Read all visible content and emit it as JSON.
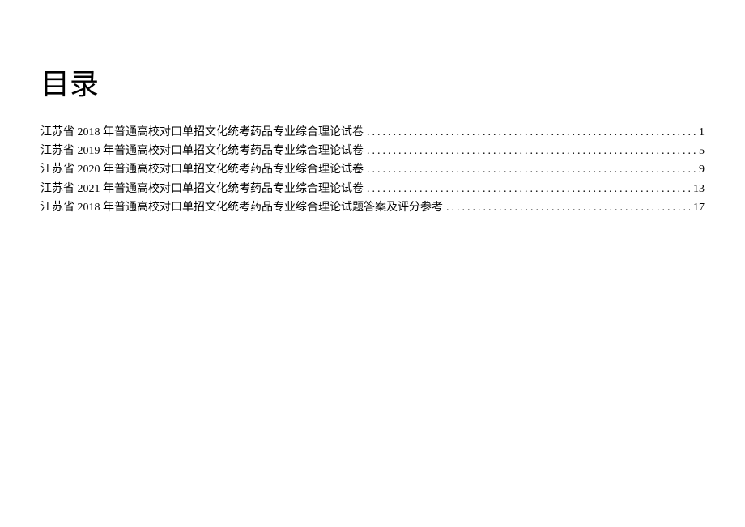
{
  "title": "目录",
  "toc": [
    {
      "title": "江苏省 2018 年普通高校对口单招文化统考药品专业综合理论试卷",
      "page": "1"
    },
    {
      "title": "江苏省 2019 年普通高校对口单招文化统考药品专业综合理论试卷",
      "page": "5"
    },
    {
      "title": "江苏省 2020 年普通高校对口单招文化统考药品专业综合理论试卷",
      "page": "9"
    },
    {
      "title": "江苏省 2021 年普通高校对口单招文化统考药品专业综合理论试卷",
      "page": "13"
    },
    {
      "title": "江苏省 2018 年普通高校对口单招文化统考药品专业综合理论试题答案及评分参考",
      "page": "17"
    }
  ]
}
